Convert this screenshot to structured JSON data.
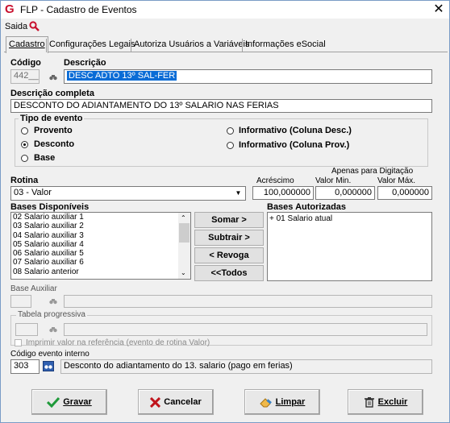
{
  "window": {
    "title": "FLP - Cadastro de Eventos",
    "close": "✕"
  },
  "menu": {
    "saida": "Saida"
  },
  "tabs": [
    "Cadastro",
    "Configurações Legais",
    "Autoriza Usuários a Variáveis",
    "Informações eSocial"
  ],
  "codigo": {
    "label": "Código",
    "value": "442__"
  },
  "descricao": {
    "label": "Descrição",
    "value": "DESC ADTO 13º SAL-FER"
  },
  "descricao_completa": {
    "label": "Descrição completa",
    "value": "DESCONTO DO ADIANTAMENTO DO 13º SALARIO NAS FERIAS"
  },
  "tipo_evento": {
    "label": "Tipo de evento",
    "options": [
      "Provento",
      "Desconto",
      "Base",
      "Informativo (Coluna Desc.)",
      "Informativo (Coluna Prov.)"
    ],
    "selected": "Desconto"
  },
  "rotina": {
    "label": "Rotina",
    "value": "03 - Valor"
  },
  "apenas_digitacao": "Apenas para Digitação",
  "acrescimo": {
    "label": "Acréscimo",
    "value": "100,000000"
  },
  "valor_min": {
    "label": "Valor Min.",
    "value": "0,000000"
  },
  "valor_max": {
    "label": "Valor Máx.",
    "value": "0,000000"
  },
  "bases_disponiveis": {
    "label": "Bases Disponíveis",
    "items": [
      "02 Salario auxiliar 1",
      "03 Salario auxiliar 2",
      "04 Salario auxiliar 3",
      "05 Salario auxiliar 4",
      "06 Salario auxiliar 5",
      "07 Salario auxiliar 6",
      "08 Salario anterior"
    ]
  },
  "bases_autorizadas": {
    "label": "Bases Autorizadas",
    "items": [
      "+ 01 Salario atual"
    ]
  },
  "buttons": {
    "somar": "Somar >",
    "subtrair": "Subtrair >",
    "revoga": "< Revoga",
    "todos": "<<Todos"
  },
  "base_auxiliar": {
    "label": "Base Auxiliar"
  },
  "tabela_progressiva": {
    "label": "Tabela progressiva"
  },
  "imprimir_valor": {
    "label": "Imprimir valor na referência (evento de rotina Valor)"
  },
  "codigo_evento_interno": {
    "label": "Código evento interno",
    "code": "303",
    "desc": "Desconto do adiantamento do 13. salario (pago em ferias)"
  },
  "footer": {
    "gravar": "Gravar",
    "cancelar": "Cancelar",
    "limpar": "Limpar",
    "excluir": "Excluir"
  },
  "colors": {
    "brand": "#c8102e",
    "selection": "#0a6cd6",
    "ok_check": "#1f9a3a",
    "cancel_x": "#c0141c"
  }
}
